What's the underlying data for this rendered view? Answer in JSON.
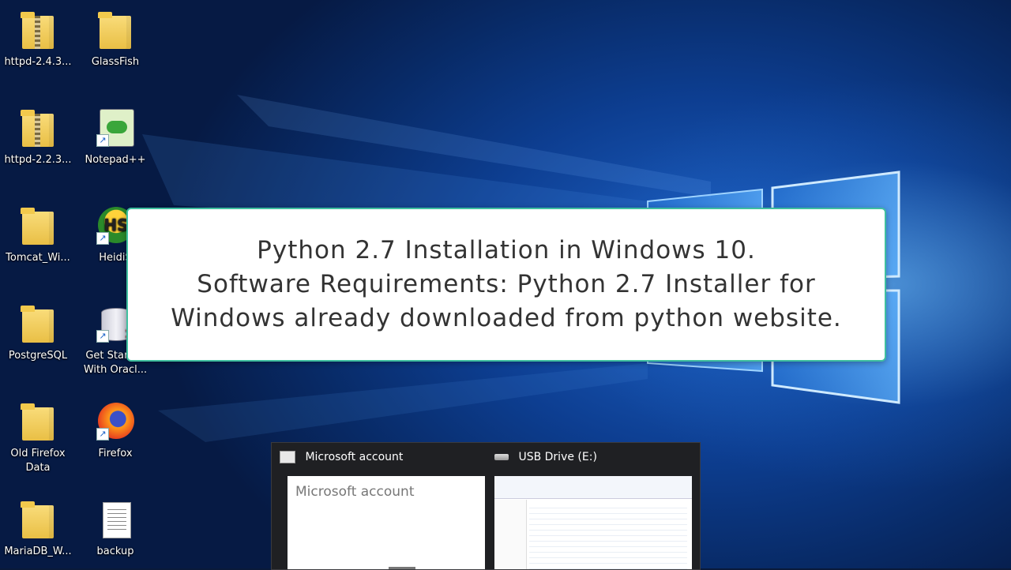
{
  "desktop": {
    "icons": [
      {
        "label": "httpd-2.4.3...",
        "type": "zip-folder"
      },
      {
        "label": "GlassFish",
        "type": "folder"
      },
      {
        "label": "httpd-2.2.3...",
        "type": "zip-folder"
      },
      {
        "label": "Notepad++",
        "type": "notepad-app"
      },
      {
        "label": "Tomcat_Wi...",
        "type": "folder"
      },
      {
        "label": "HeidiS",
        "type": "heidisql-app"
      },
      {
        "label": "PostgreSQL",
        "type": "folder"
      },
      {
        "label": "Get Started With Oracl...",
        "type": "oracle-db-app"
      },
      {
        "label": "Old Firefox Data",
        "type": "folder"
      },
      {
        "label": "Firefox",
        "type": "firefox-app"
      },
      {
        "label": "MariaDB_W...",
        "type": "folder"
      },
      {
        "label": "backup",
        "type": "document"
      }
    ]
  },
  "notice": {
    "line1": "Python 2.7 Installation in Windows 10.",
    "line2": "Software Requirements: Python 2.7 Installer for",
    "line3": "Windows already downloaded from python website."
  },
  "taskbar_preview": {
    "items": [
      {
        "title": "Microsoft account",
        "thumb_text": "Microsoft account"
      },
      {
        "title": "USB Drive (E:)"
      }
    ]
  },
  "colors": {
    "accent_border": "#3fbf9f",
    "wallpaper_blue": "#1e63c8",
    "preview_bg": "#1f2023"
  }
}
